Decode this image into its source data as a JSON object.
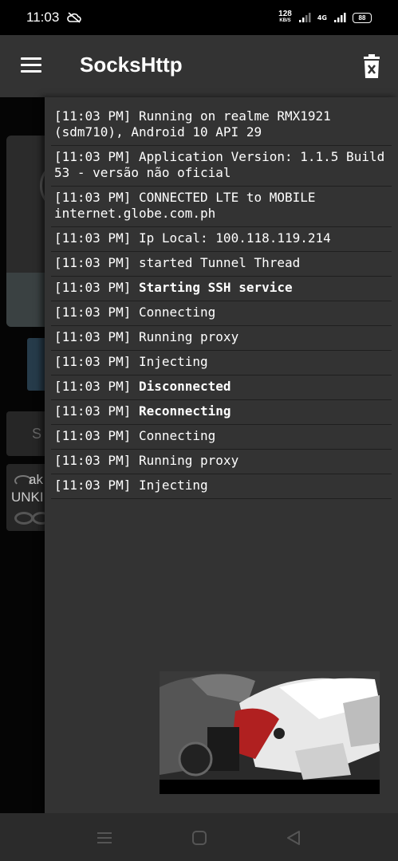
{
  "status_bar": {
    "time": "11:03",
    "speed_value": "128",
    "speed_unit": "KB/S",
    "network_type": "4G",
    "battery_level": "88"
  },
  "app_bar": {
    "title": "SocksHttp",
    "menu_icon": "hamburger-menu-icon",
    "clear_icon": "trash-icon"
  },
  "background_app": {
    "char_1": "S",
    "text_1": "ak",
    "text_2": "UNKI"
  },
  "logs": [
    {
      "time": "[11:03 PM]",
      "message": "Running on realme RMX1921 (sdm710), Android 10 API 29",
      "bold": false
    },
    {
      "time": "[11:03 PM]",
      "message": "Application Version: 1.1.5 Build 53 - versão não oficial",
      "bold": false
    },
    {
      "time": "[11:03 PM]",
      "message": "CONNECTED LTE to MOBILE internet.globe.com.ph",
      "bold": false
    },
    {
      "time": "[11:03 PM]",
      "message": "Ip Local: 100.118.119.214",
      "bold": false
    },
    {
      "time": "[11:03 PM]",
      "message": "started Tunnel Thread",
      "bold": false
    },
    {
      "time": "[11:03 PM]",
      "message": "Starting SSH service",
      "bold": true
    },
    {
      "time": "[11:03 PM]",
      "message": "Connecting",
      "bold": false
    },
    {
      "time": "[11:03 PM]",
      "message": "Running proxy",
      "bold": false
    },
    {
      "time": "[11:03 PM]",
      "message": "Injecting",
      "bold": false
    },
    {
      "time": "[11:03 PM]",
      "message": "Disconnected",
      "bold": true
    },
    {
      "time": "[11:03 PM]",
      "message": "Reconnecting",
      "bold": true
    },
    {
      "time": "[11:03 PM]",
      "message": "Connecting",
      "bold": false
    },
    {
      "time": "[11:03 PM]",
      "message": "Running proxy",
      "bold": false
    },
    {
      "time": "[11:03 PM]",
      "message": "Injecting",
      "bold": false
    }
  ],
  "colors": {
    "app_bar": "#333333",
    "drawer": "#333333",
    "status_bar": "#000000",
    "log_text": "#ffffff"
  }
}
